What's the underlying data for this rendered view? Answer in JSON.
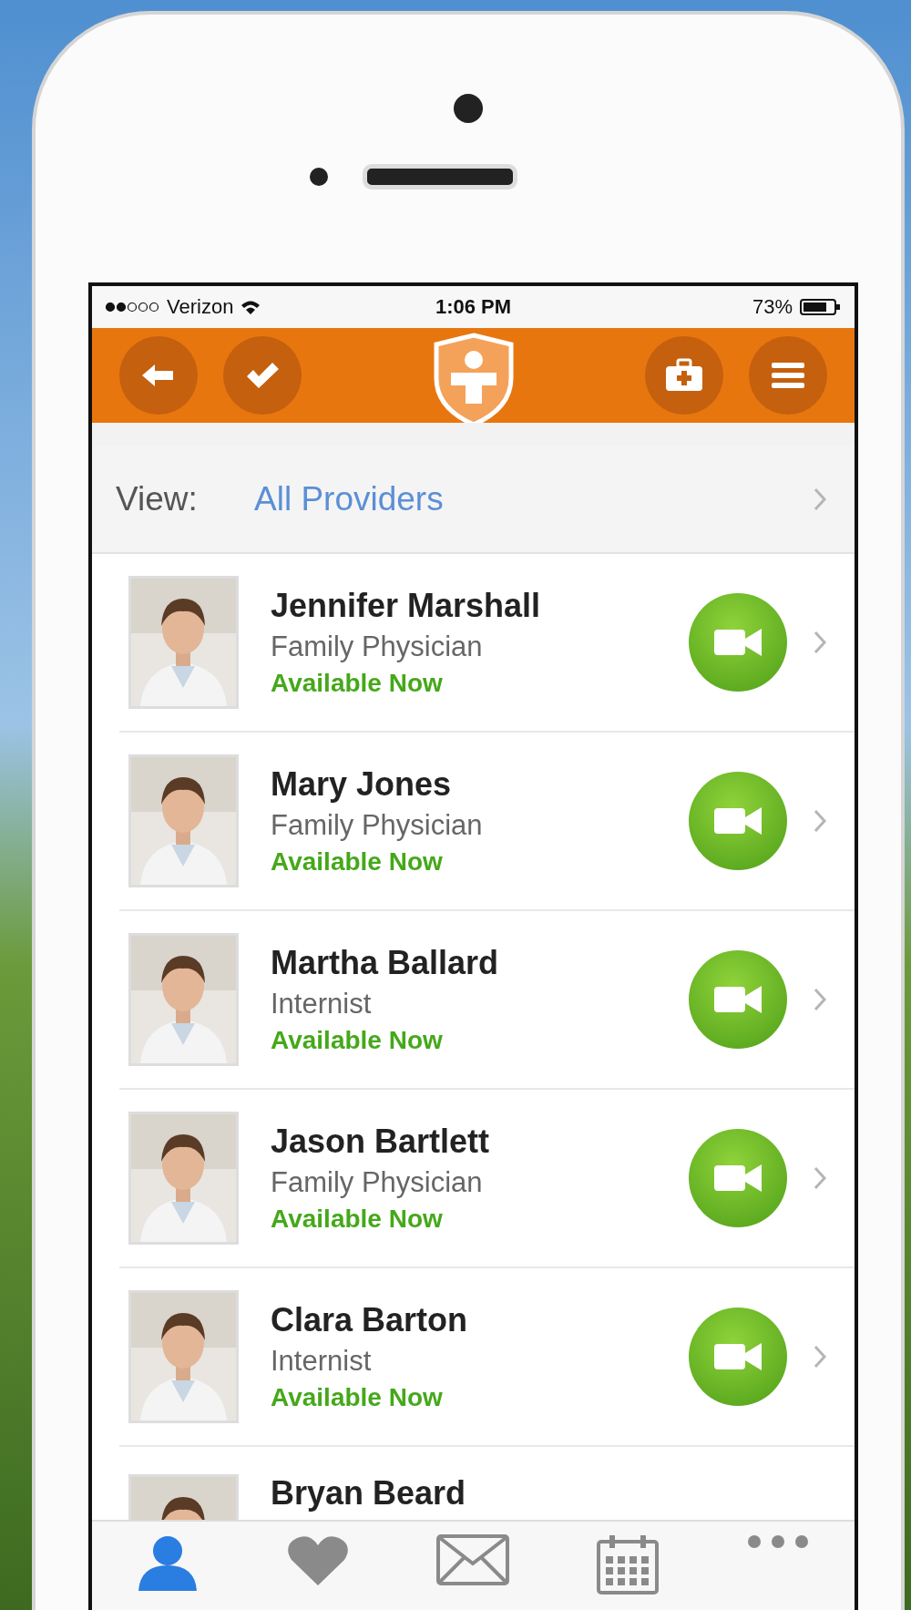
{
  "status_bar": {
    "carrier": "Verizon",
    "time": "1:06 PM",
    "battery": "73%"
  },
  "view": {
    "label": "View:",
    "value": "All Providers"
  },
  "providers": [
    {
      "name": "Jennifer Marshall",
      "specialty": "Family Physician",
      "status": "Available Now"
    },
    {
      "name": "Mary Jones",
      "specialty": "Family Physician",
      "status": "Available Now"
    },
    {
      "name": "Martha Ballard",
      "specialty": "Internist",
      "status": "Available Now"
    },
    {
      "name": "Jason Bartlett",
      "specialty": "Family Physician",
      "status": "Available Now"
    },
    {
      "name": "Clara Barton",
      "specialty": "Internist",
      "status": "Available Now"
    },
    {
      "name": "Bryan Beard"
    }
  ],
  "tab_bar": {
    "tabs": [
      {
        "kind": "person",
        "selected": true
      },
      {
        "kind": "heart",
        "selected": false
      },
      {
        "kind": "mail",
        "selected": false
      },
      {
        "kind": "calendar",
        "selected": false
      },
      {
        "kind": "more",
        "selected": false
      }
    ]
  }
}
